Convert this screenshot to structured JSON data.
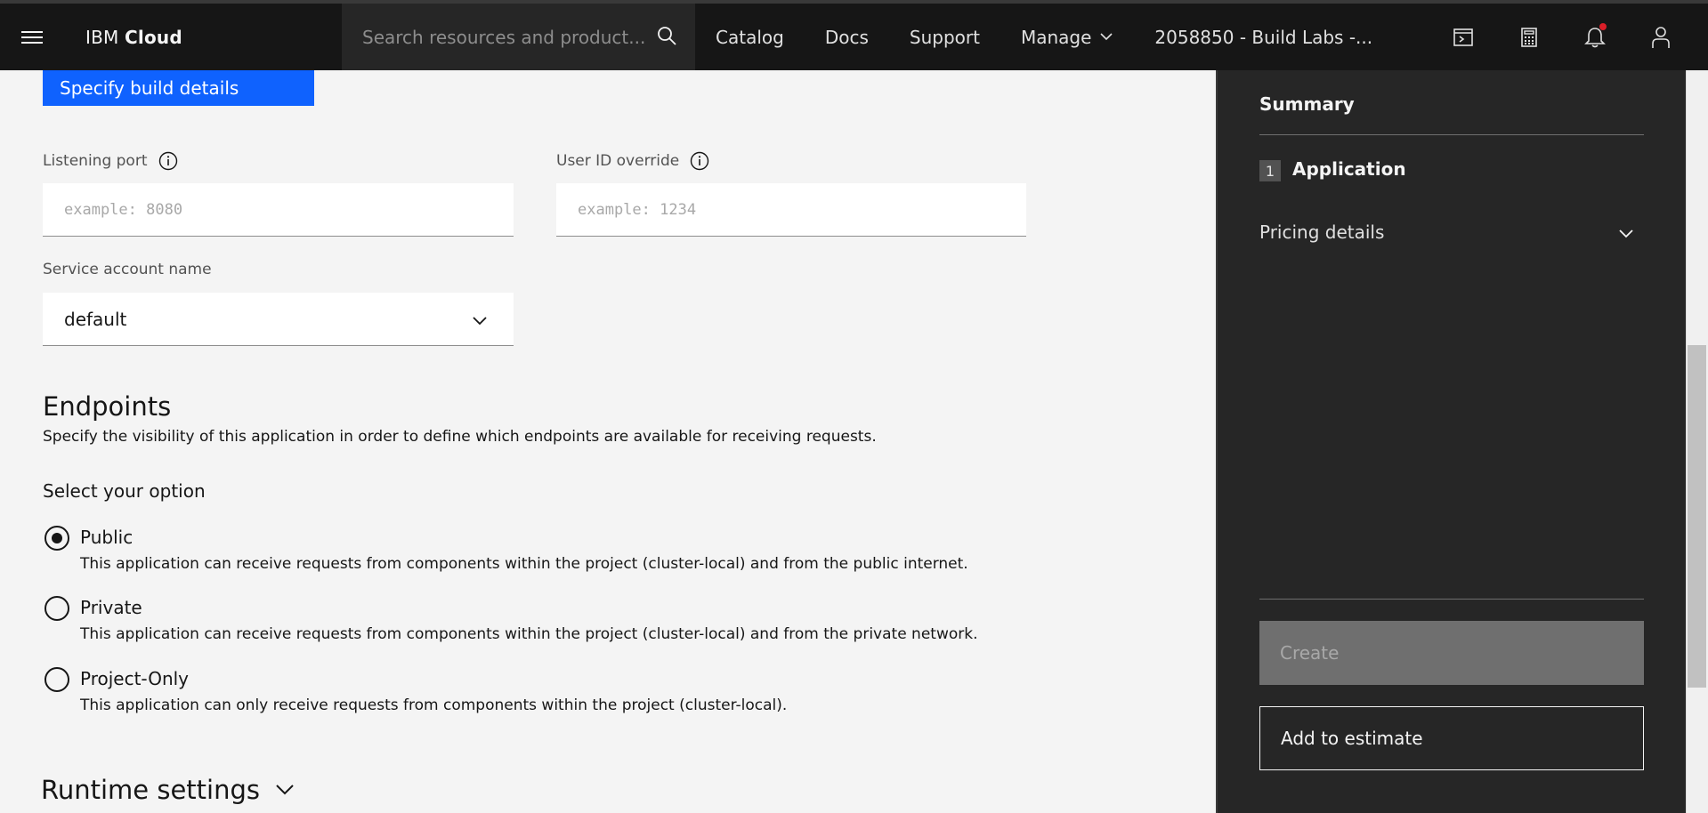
{
  "header": {
    "brand_prefix": "IBM",
    "brand_name": "Cloud",
    "search_placeholder": "Search resources and product...",
    "nav": {
      "catalog": "Catalog",
      "docs": "Docs",
      "support": "Support",
      "manage": "Manage",
      "account": "2058850 - Build Labs -..."
    },
    "icons": [
      "terminal-icon",
      "calculator-icon",
      "notification-icon",
      "user-icon"
    ]
  },
  "main": {
    "build_button": "Specify build details",
    "listening_port": {
      "label": "Listening port",
      "placeholder": "example: 8080",
      "value": ""
    },
    "user_id_override": {
      "label": "User ID override",
      "placeholder": "example: 1234",
      "value": ""
    },
    "service_account": {
      "label": "Service account name",
      "value": "default"
    },
    "endpoints": {
      "title": "Endpoints",
      "description": "Specify the visibility of this application in order to define which endpoints are available for receiving requests.",
      "option_heading": "Select your option",
      "options": [
        {
          "label": "Public",
          "description": "This application can receive requests from components within the project (cluster-local) and from the public internet.",
          "selected": true
        },
        {
          "label": "Private",
          "description": "This application can receive requests from components within the project (cluster-local) and from the private network.",
          "selected": false
        },
        {
          "label": "Project-Only",
          "description": "This application can only receive requests from components within the project (cluster-local).",
          "selected": false
        }
      ]
    },
    "runtime_settings": "Runtime settings"
  },
  "summary": {
    "title": "Summary",
    "step_number": "1",
    "step_label": "Application",
    "pricing_label": "Pricing details",
    "create_button": "Create",
    "estimate_button": "Add to estimate"
  },
  "colors": {
    "header_bg": "#161616",
    "panel_bg": "#262626",
    "primary_blue": "#0f62fe",
    "notification_dot": "#da1e28"
  }
}
